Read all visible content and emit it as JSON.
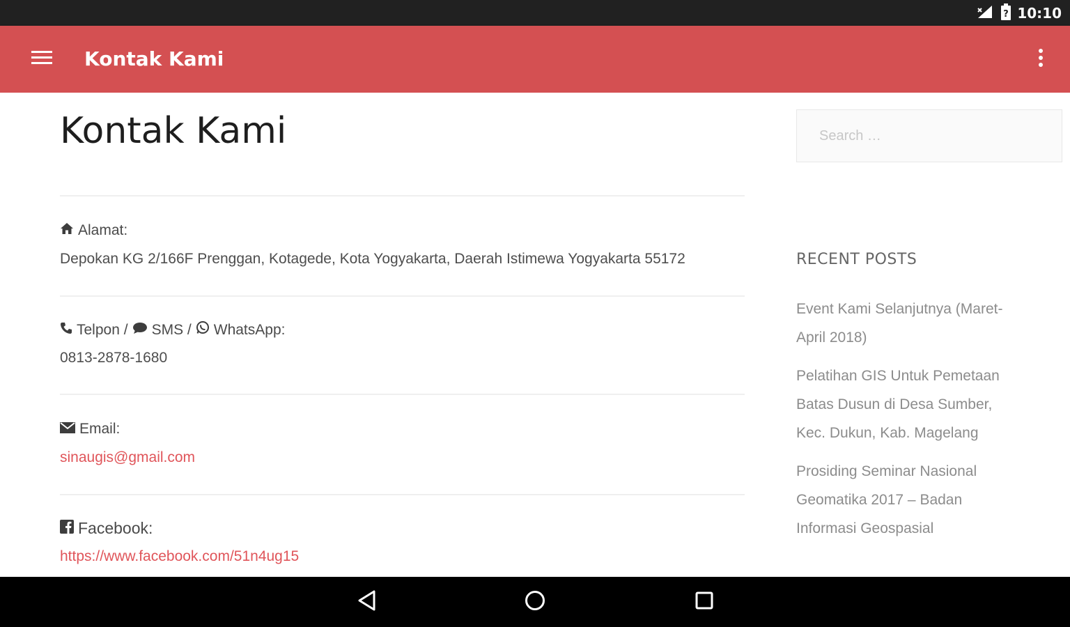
{
  "status_bar": {
    "time": "10:10",
    "icons": [
      "signal-icon",
      "battery-icon"
    ]
  },
  "app_bar": {
    "title": "Kontak Kami",
    "menu_icon": "hamburger-menu-icon",
    "overflow_icon": "more-vert-icon",
    "color": "#d45052"
  },
  "page": {
    "title": "Kontak Kami",
    "address": {
      "label": "Alamat:",
      "value": "Depokan KG 2/166F Prenggan, Kotagede, Kota Yogyakarta, Daerah Istimewa Yogyakarta 55172"
    },
    "phone": {
      "label_telpon": "Telpon /",
      "label_sms": "SMS /",
      "label_whatsapp": "WhatsApp:",
      "value": "0813-2878-1680"
    },
    "email": {
      "label": "Email:",
      "value": "sinaugis@gmail.com"
    },
    "facebook": {
      "label": "Facebook:",
      "value": "https://www.facebook.com/51n4ug15"
    },
    "link_color": "#e0555a"
  },
  "sidebar": {
    "search_placeholder": "Search …",
    "recent_posts_heading": "RECENT POSTS",
    "recent_posts": [
      "Event Kami Selanjutnya (Maret-April 2018)",
      "Pelatihan GIS Untuk Pemetaan Batas Dusun di Desa Sumber, Kec. Dukun, Kab. Magelang",
      "Prosiding Seminar Nasional Geomatika 2017 – Badan Informasi Geospasial"
    ]
  },
  "nav_bar": {
    "buttons": [
      "back-icon",
      "home-icon",
      "recents-icon"
    ]
  }
}
